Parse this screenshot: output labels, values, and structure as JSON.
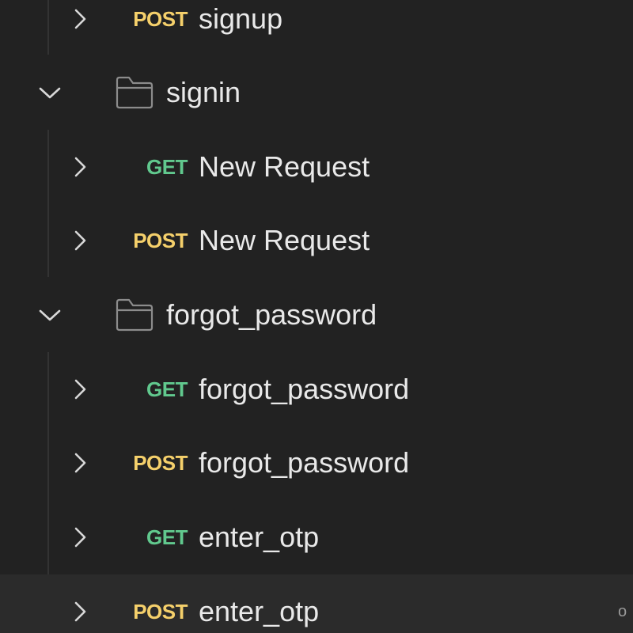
{
  "tree": {
    "items": [
      {
        "method": "POST",
        "name": "signup"
      },
      {
        "folder": "signin"
      },
      {
        "method": "GET",
        "name": "New Request"
      },
      {
        "method": "POST",
        "name": "New Request"
      },
      {
        "folder": "forgot_password"
      },
      {
        "method": "GET",
        "name": "forgot_password"
      },
      {
        "method": "POST",
        "name": "forgot_password"
      },
      {
        "method": "GET",
        "name": "enter_otp"
      },
      {
        "method": "POST",
        "name": "enter_otp"
      }
    ],
    "more_glyph": "o"
  },
  "colors": {
    "background": "#222222",
    "post_method": "#f5d06b",
    "get_method": "#61c98e",
    "text": "#e9e9e9",
    "hover_row": "#2b2b2b"
  },
  "icons": {
    "collapsed": "chevron-right-icon",
    "expanded": "chevron-down-icon",
    "folder": "folder-icon"
  }
}
